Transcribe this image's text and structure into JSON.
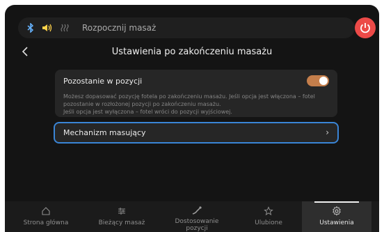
{
  "status_bar": {
    "title": "Rozpocznij masaż",
    "icons": [
      "bluetooth-icon",
      "sound-icon",
      "heat-icon"
    ],
    "power_color": "#ec4a48"
  },
  "header": {
    "title": "Ustawienia po zakończeniu masażu"
  },
  "settings": {
    "stay_in_position": {
      "label": "Pozostanie w pozycji",
      "enabled": true,
      "description": [
        "Możesz dopasować pozycję fotela po zakończeniu masażu. Jeśli opcja jest włączona – fotel",
        "pozostanie w rozłożonej pozycji po zakończeniu masażu.",
        "Jeśli opcja jest wyłączona – fotel wróci do pozycji wyjściowej."
      ]
    },
    "massage_mechanism": {
      "label": "Mechanizm masujący",
      "chevron": "›"
    }
  },
  "bottom_nav": {
    "items": [
      {
        "label": "Strona główna",
        "icon": "home-icon"
      },
      {
        "label": "Bieżący masaż",
        "icon": "sliders-icon"
      },
      {
        "label": "Dostosowanie pozycji",
        "icon": "recline-icon"
      },
      {
        "label": "Ulubione",
        "icon": "star-icon"
      },
      {
        "label": "Ustawienia",
        "icon": "gear-icon",
        "active": true
      }
    ]
  },
  "colors": {
    "background": "#141414",
    "accent_toggle": "#c47e4b",
    "focus_border": "#3a85d6"
  }
}
